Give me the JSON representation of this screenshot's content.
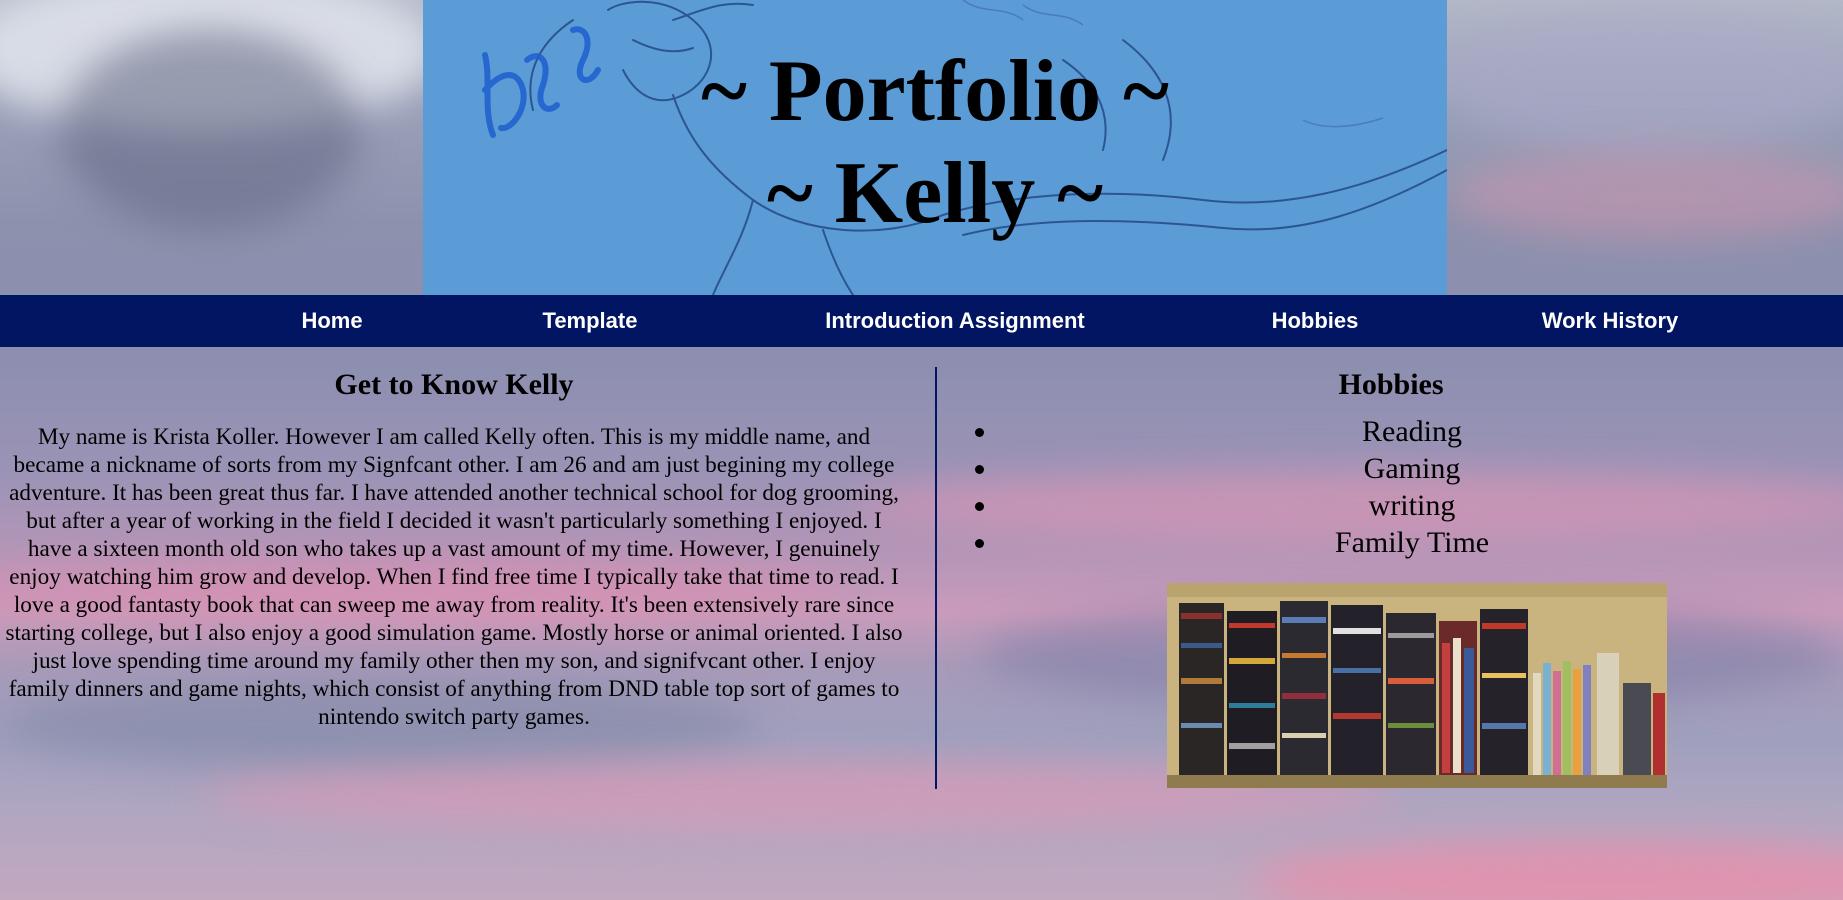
{
  "header": {
    "title_line1": "~ Portfolio ~",
    "title_line2": "~ Kelly ~",
    "artwork_signature": "Zebo"
  },
  "nav": {
    "items": [
      "Home",
      "Template",
      "Introduction Assignment",
      "Hobbies",
      "Work History"
    ]
  },
  "about": {
    "heading": "Get to Know Kelly",
    "body": "My name is Krista Koller. However I am called Kelly often. This is my middle name, and became a nickname of sorts from my Signfcant other. I am 26 and am just begining my college adventure. It has been great thus far. I have attended another technical school for dog grooming, but after a year of working in the field I decided it wasn't particularly something I enjoyed. I have a sixteen month old son who takes up a vast amount of my time. However, I genuinely enjoy watching him grow and develop. When I find free time I typically take that time to read. I love a good fantasty book that can sweep me away from reality. It's been extensively rare since starting college, but I also enjoy a good simulation game. Mostly horse or animal oriented. I also just love spending time around my family other then my son, and signifvcant other. I enjoy family dinners and game nights, which consist of anything from DND table top sort of games to nintendo switch party games."
  },
  "hobbies": {
    "heading": "Hobbies",
    "items": [
      "Reading",
      "Gaming",
      "writing",
      "Family Time"
    ]
  },
  "colors": {
    "header_bg": "#5b9bd6",
    "nav_bg": "#011563",
    "nav_text": "#ffffff",
    "divider": "#011563"
  },
  "icons": {
    "bullet": "filled-circle"
  }
}
